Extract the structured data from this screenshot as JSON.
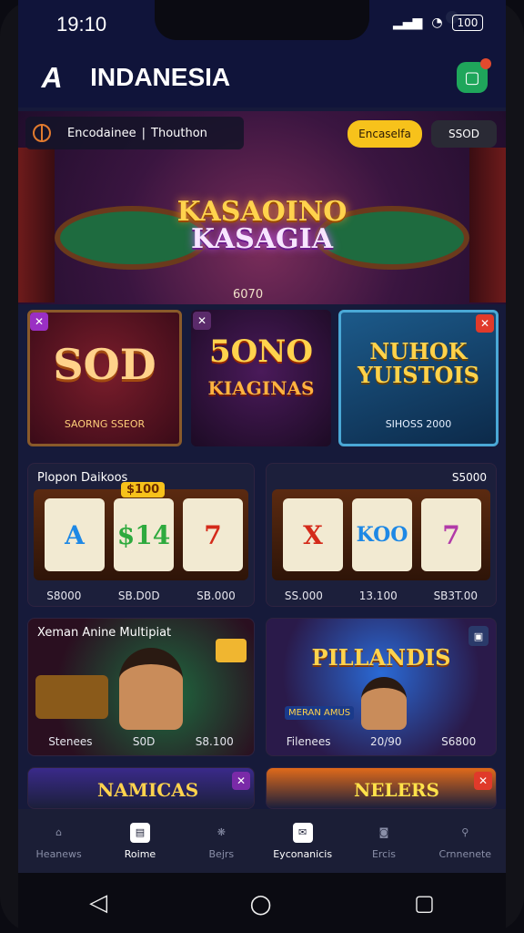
{
  "status": {
    "time": "19:10",
    "battery": "100"
  },
  "app": {
    "logo": "A",
    "title": "INDANESIA"
  },
  "topbar": {
    "lang_primary": "Encodainee",
    "separator": "|",
    "lang_secondary": "Thouthon",
    "yellow_button": "Encaselfa",
    "dark_button": "SSOD"
  },
  "hero": {
    "title_line1": "KASAOINO",
    "title_line2": "KASAGIA",
    "subtitle": "6070"
  },
  "featured": [
    {
      "title": "SOD",
      "subtitle": "SAORNG SSEOR"
    },
    {
      "title": "5ONO",
      "subtitle2": "KIAGINAS"
    },
    {
      "title": "NUHOK YUISTOIS",
      "subtitle": "SIHOSS 2000"
    }
  ],
  "slots": [
    {
      "header": "Plopon Daikoos",
      "top_value": "$100",
      "reels": [
        "A",
        "$14",
        "7"
      ],
      "footer": [
        "S8000",
        "SB.D0D",
        "SB.000"
      ]
    },
    {
      "header": "",
      "top_value": "S5000",
      "reels": [
        "X",
        "KOO",
        "7"
      ],
      "footer": [
        "SS.000",
        "13.100",
        "SB3T.00"
      ]
    }
  ],
  "promos": [
    {
      "header": "Xeman Anine Multipiat",
      "footer": [
        "Stenees",
        "S0D",
        "S8.100"
      ]
    },
    {
      "header": "PILLANDIS",
      "title2": "MERAN AMUS",
      "footer": [
        "Filenees",
        "20/90",
        "S6800"
      ]
    }
  ],
  "partial_cards": [
    {
      "title": "NAMICAS"
    },
    {
      "title": "NELERS"
    }
  ],
  "nav": [
    {
      "label": "Heanews",
      "icon": "home-icon"
    },
    {
      "label": "Roime",
      "icon": "chat-icon"
    },
    {
      "label": "Bejrs",
      "icon": "paw-icon"
    },
    {
      "label": "Eyconanicis",
      "icon": "message-icon"
    },
    {
      "label": "Ercis",
      "icon": "camera-icon"
    },
    {
      "label": "Crnnenete",
      "icon": "search-icon"
    }
  ],
  "colors": {
    "accent_yellow": "#f7c21b",
    "bg_navy": "#161a3a",
    "nav_bg": "#1b1e36"
  }
}
